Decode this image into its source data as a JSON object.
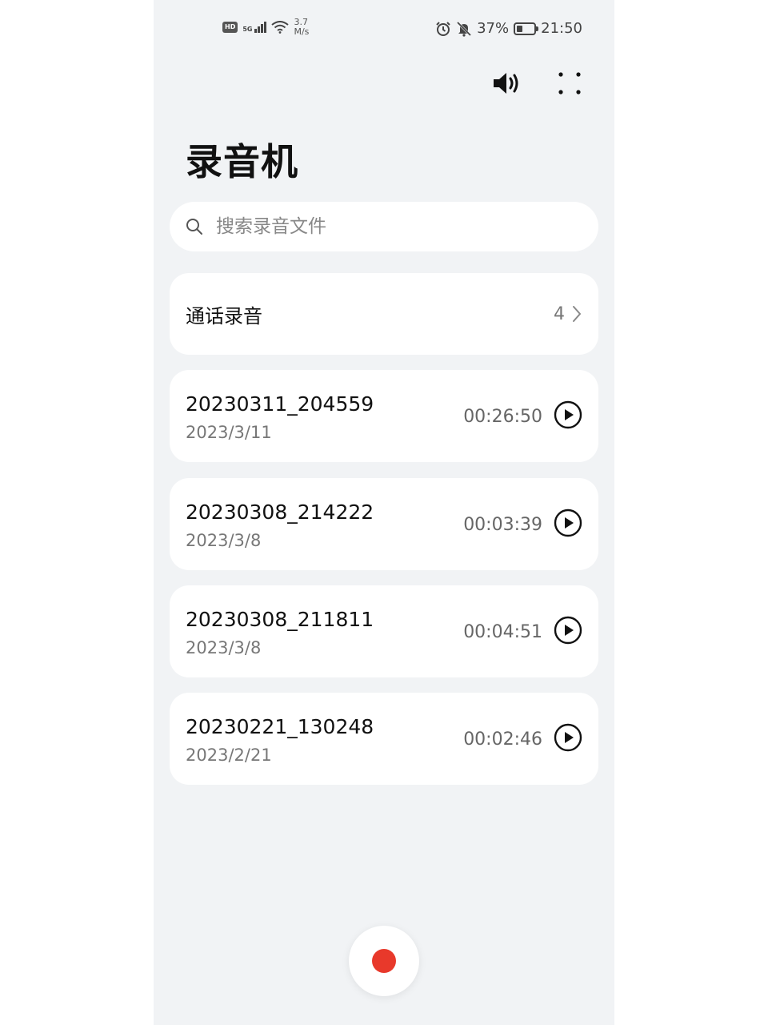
{
  "status_bar": {
    "hd": "HD",
    "network": "5G",
    "speed_value": "3.7",
    "speed_unit": "M/s",
    "battery_percent": "37%",
    "battery_level": 0.37,
    "time": "21:50",
    "icons": [
      "signal-icon",
      "wifi-icon",
      "alarm-icon",
      "mute-icon",
      "battery-icon"
    ]
  },
  "header": {
    "title": "录音机",
    "speaker_icon": "speaker-icon",
    "more_icon": "more-icon"
  },
  "search": {
    "placeholder": "搜索录音文件",
    "value": "",
    "icon": "search-icon"
  },
  "call_recordings": {
    "label": "通话录音",
    "count": "4",
    "icon": "chevron-right-icon"
  },
  "recordings": [
    {
      "name": "20230311_204559",
      "date": "2023/3/11",
      "duration": "00:26:50"
    },
    {
      "name": "20230308_214222",
      "date": "2023/3/8",
      "duration": "00:03:39"
    },
    {
      "name": "20230308_211811",
      "date": "2023/3/8",
      "duration": "00:04:51"
    },
    {
      "name": "20230221_130248",
      "date": "2023/2/21",
      "duration": "00:02:46"
    }
  ],
  "colors": {
    "background": "#f1f3f5",
    "card": "#ffffff",
    "record_accent": "#e8392b"
  }
}
